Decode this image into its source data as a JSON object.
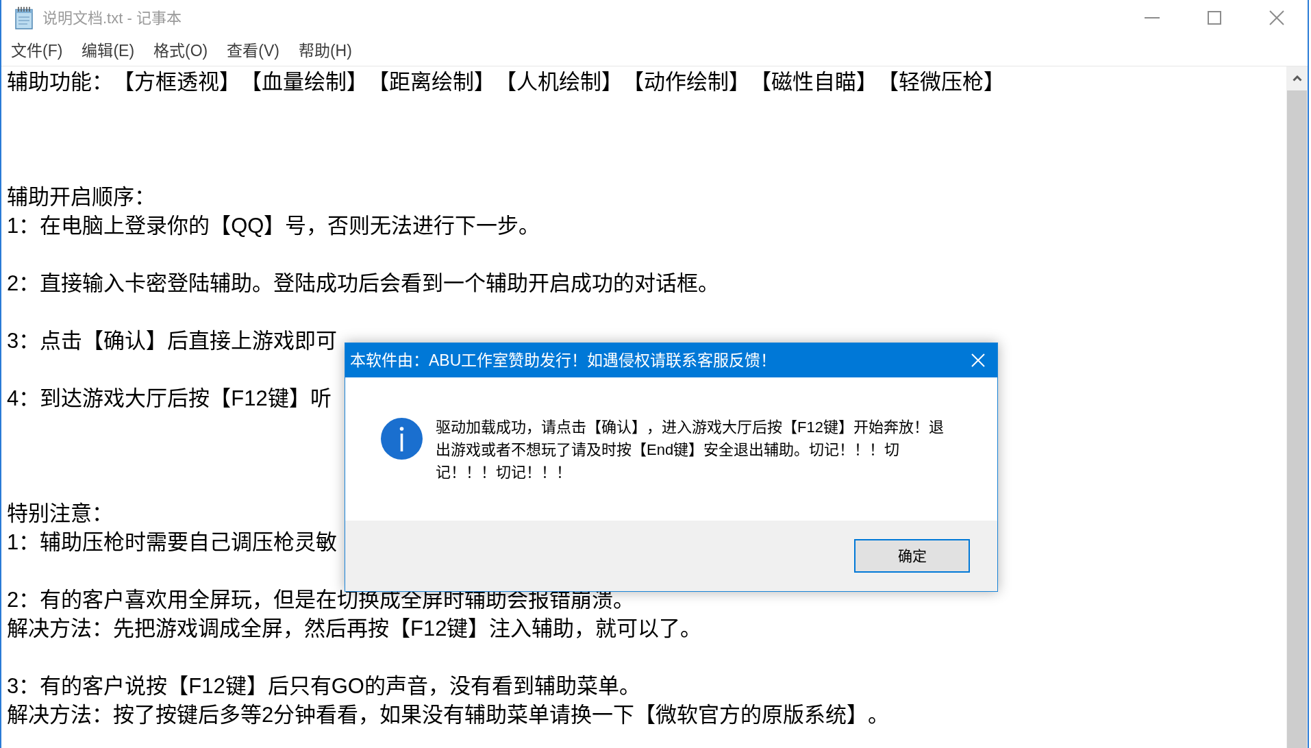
{
  "window": {
    "title": "说明文档.txt - 记事本",
    "active": false
  },
  "menu": [
    "文件(F)",
    "编辑(E)",
    "格式(O)",
    "查看(V)",
    "帮助(H)"
  ],
  "editor": {
    "lines": [
      {
        "kind": "text",
        "text": "辅助功能：【方框透视】【血量绘制】【距离绘制】【人机绘制】【动作绘制】【磁性自瞄】【轻微压枪】"
      },
      {
        "kind": "blank"
      },
      {
        "kind": "blank"
      },
      {
        "kind": "blank"
      },
      {
        "kind": "text",
        "text": "辅助开启顺序："
      },
      {
        "kind": "text",
        "text": "1：在电脑上登录你的【QQ】号，否则无法进行下一步。"
      },
      {
        "kind": "blank"
      },
      {
        "kind": "text",
        "text": "2：直接输入卡密登陆辅助。登陆成功后会看到一个辅助开启成功的对话框。"
      },
      {
        "kind": "blank"
      },
      {
        "kind": "text",
        "text": "3：点击【确认】后直接上游戏即可"
      },
      {
        "kind": "blank"
      },
      {
        "kind": "text",
        "text": "4：到达游戏大厅后按【F12键】听"
      },
      {
        "kind": "blank"
      },
      {
        "kind": "blank"
      },
      {
        "kind": "blank"
      },
      {
        "kind": "text",
        "text": "特别注意："
      },
      {
        "kind": "text",
        "text": "1：辅助压枪时需要自己调压枪灵敏"
      },
      {
        "kind": "blank"
      },
      {
        "kind": "text",
        "text": "2：有的客户喜欢用全屏玩，但是在切换成全屏时辅助会报错崩溃。"
      },
      {
        "kind": "text",
        "text": "解决方法：先把游戏调成全屏，然后再按【F12键】注入辅助，就可以了。"
      },
      {
        "kind": "blank"
      },
      {
        "kind": "text",
        "text": "3：有的客户说按【F12键】后只有GO的声音，没有看到辅助菜单。"
      },
      {
        "kind": "text",
        "text": "解决方法：按了按键后多等2分钟看看，如果没有辅助菜单请换一下【微软官方的原版系统】。"
      }
    ]
  },
  "dialog": {
    "title": "本软件由：ABU工作室赞助发行！如遇侵权请联系客服反馈！",
    "message": "驱动加载成功，请点击【确认】，进入游戏大厅后按【F12键】开始奔放！退出游戏或者不想玩了请及时按【End键】安全退出辅助。切记！！！切记！！！切记！！！",
    "buttons": [
      {
        "label": "确定",
        "focused": true
      }
    ]
  }
}
